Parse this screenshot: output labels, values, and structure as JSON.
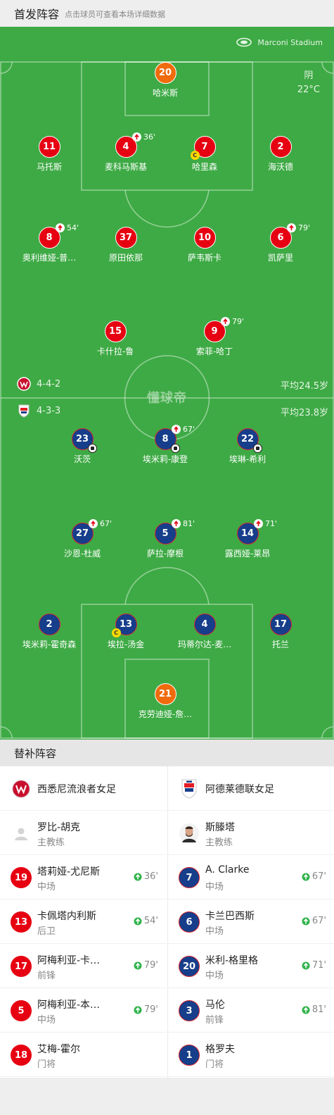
{
  "header": {
    "title": "首发阵容",
    "subtitle": "点击球员可查看本场详细数据"
  },
  "pitch": {
    "stadium": "Marconi Stadium",
    "weather": {
      "condition": "阴",
      "temperature": "22°C"
    },
    "watermark": "懂球帝",
    "home": {
      "formation": "4-4-2",
      "avg_age": "平均24.5岁"
    },
    "away": {
      "formation": "4-3-3",
      "avg_age": "平均23.8岁"
    }
  },
  "home_players": [
    {
      "num": "20",
      "name": "哈米斯",
      "color": "orange"
    },
    {
      "num": "11",
      "name": "马托斯",
      "color": "red"
    },
    {
      "num": "4",
      "name": "麦科马斯基",
      "color": "red",
      "sub": "36'"
    },
    {
      "num": "7",
      "name": "哈里森",
      "color": "red",
      "captain": true
    },
    {
      "num": "2",
      "name": "海沃德",
      "color": "red"
    },
    {
      "num": "8",
      "name": "奥利维娅-普…",
      "color": "red",
      "sub": "54'"
    },
    {
      "num": "37",
      "name": "原田依那",
      "color": "red"
    },
    {
      "num": "10",
      "name": "萨韦斯卡",
      "color": "red"
    },
    {
      "num": "6",
      "name": "凯萨里",
      "color": "red",
      "sub": "79'"
    },
    {
      "num": "15",
      "name": "卡什拉-鲁",
      "color": "red"
    },
    {
      "num": "9",
      "name": "索菲-哈丁",
      "color": "red",
      "sub": "79'"
    }
  ],
  "away_players": [
    {
      "num": "23",
      "name": "沃茨",
      "color": "blue",
      "ball": true
    },
    {
      "num": "8",
      "name": "埃米莉-康登",
      "color": "blue",
      "sub": "67'",
      "ball": true
    },
    {
      "num": "22",
      "name": "埃琳-希利",
      "color": "blue",
      "ball": true
    },
    {
      "num": "27",
      "name": "沙恩-杜威",
      "color": "blue",
      "sub": "67'"
    },
    {
      "num": "5",
      "name": "萨拉-摩根",
      "color": "blue",
      "sub": "81'"
    },
    {
      "num": "14",
      "name": "露西娅-莱昂",
      "color": "blue",
      "sub": "71'"
    },
    {
      "num": "2",
      "name": "埃米莉-霍奇森",
      "color": "blue"
    },
    {
      "num": "13",
      "name": "埃拉-汤金",
      "color": "blue",
      "captain": true
    },
    {
      "num": "4",
      "name": "玛蒂尔达-麦…",
      "color": "blue"
    },
    {
      "num": "17",
      "name": "托兰",
      "color": "blue"
    },
    {
      "num": "21",
      "name": "克劳迪娅-詹…",
      "color": "orange"
    }
  ],
  "subs": {
    "title": "替补阵容",
    "home": {
      "team": "西悉尼流浪者女足",
      "coach": {
        "name": "罗比-胡克",
        "role": "主教练"
      },
      "players": [
        {
          "num": "19",
          "name": "塔莉娅-尤尼斯",
          "pos": "中场",
          "min": "36'"
        },
        {
          "num": "13",
          "name": "卡佩塔内利斯",
          "pos": "后卫",
          "min": "54'"
        },
        {
          "num": "17",
          "name": "阿梅利亚-卡…",
          "pos": "前锋",
          "min": "79'"
        },
        {
          "num": "5",
          "name": "阿梅利亚-本…",
          "pos": "中场",
          "min": "79'"
        },
        {
          "num": "18",
          "name": "艾梅-霍尔",
          "pos": "门将",
          "min": ""
        }
      ]
    },
    "away": {
      "team": "阿德莱德联女足",
      "coach": {
        "name": "斯滕塔",
        "role": "主教练"
      },
      "players": [
        {
          "num": "7",
          "name": "A. Clarke",
          "pos": "中场",
          "min": "67'"
        },
        {
          "num": "6",
          "name": "卡兰巴西斯",
          "pos": "中场",
          "min": "67'"
        },
        {
          "num": "20",
          "name": "米利-格里格",
          "pos": "中场",
          "min": "71'"
        },
        {
          "num": "3",
          "name": "马伦",
          "pos": "前锋",
          "min": "81'"
        },
        {
          "num": "1",
          "name": "格罗夫",
          "pos": "门将",
          "min": ""
        }
      ]
    }
  },
  "colors": {
    "pitch": "#3eaa45",
    "home": "#e60012",
    "away": "#163e8a",
    "keeper": "#f06b0c",
    "sub_in": "#2fb34a"
  }
}
